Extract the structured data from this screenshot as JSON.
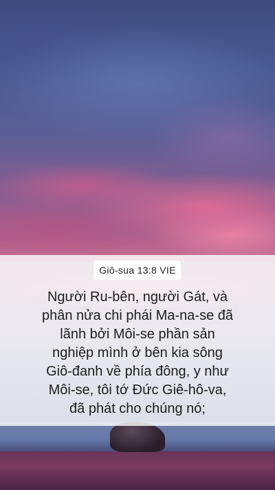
{
  "verse": {
    "reference": "Giô-sua 13:8 VIE",
    "text": "Người Ru-bên, người Gát, và\nphân nửa chi phái Ma-na-se đã\nlãnh bởi Môi-se phần sản\nnghiệp mình ở bên kia sông\nGiô-đanh về phía đông, y như\nMôi-se, tôi tớ Đức Giê-hô-va,\nđã phát cho chúng nó;"
  }
}
